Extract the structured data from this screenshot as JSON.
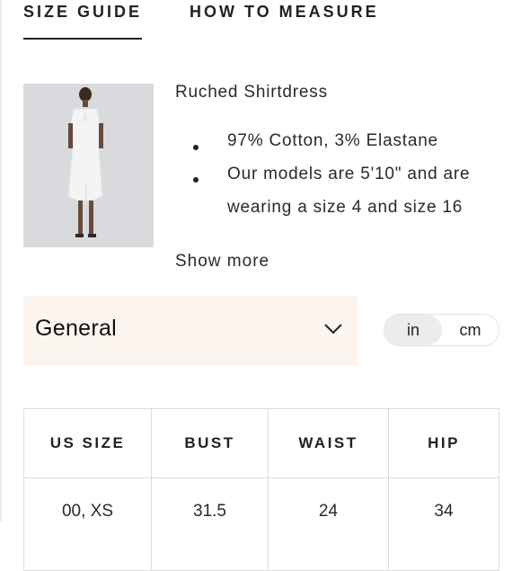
{
  "tabs": {
    "size_guide": "SIZE GUIDE",
    "how_to_measure": "HOW TO MEASURE"
  },
  "product": {
    "title": "Ruched Shirtdress",
    "details": [
      "97% Cotton, 3% Elastane",
      "Our models are 5'10\" and are",
      "wearing a size 4 and size 16"
    ],
    "show_more": "Show more"
  },
  "fit_select": {
    "value": "General",
    "icon": "chevron-down-icon"
  },
  "unit_toggle": {
    "in": "in",
    "cm": "cm",
    "selected": "in"
  },
  "size_table": {
    "headers": [
      "US SIZE",
      "BUST",
      "WAIST",
      "HIP"
    ],
    "rows": [
      [
        "00, XS",
        "31.5",
        "24",
        "34"
      ]
    ]
  },
  "colors": {
    "accent_bg": "#fcf4ef",
    "toggle_selected": "#ececec",
    "border": "#dcdcdc",
    "text": "#1a1a1a"
  }
}
